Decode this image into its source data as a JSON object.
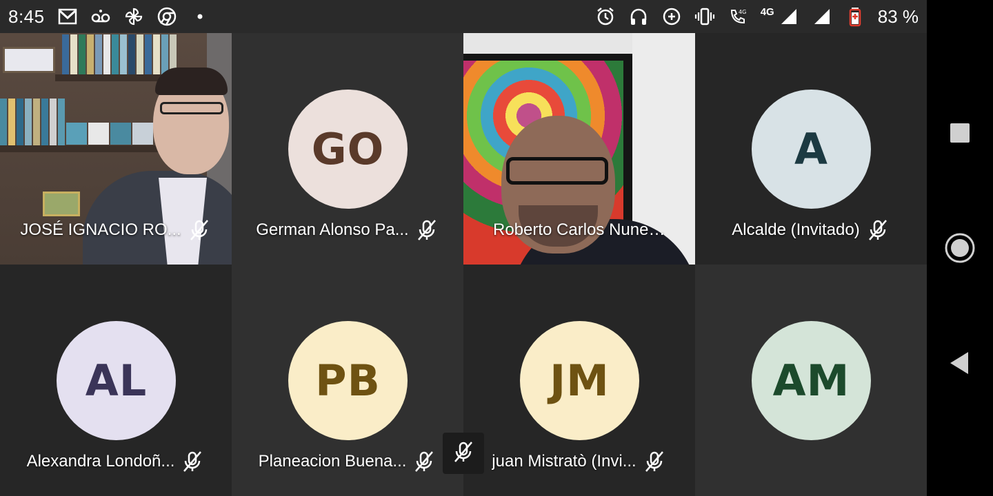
{
  "status_bar": {
    "time": "8:45",
    "left_icons": [
      "gmail-icon",
      "voicemail-icon",
      "pinwheel-icon",
      "chrome-icon",
      "notification-dot-icon"
    ],
    "right_icons": [
      "alarm-icon",
      "headphones-icon",
      "data-saver-icon",
      "vibrate-icon",
      "volte-call-icon",
      "signal-4g-icon",
      "signal-icon"
    ],
    "network_label": "4G",
    "volte_label": "4G",
    "battery_percent": "83 %"
  },
  "participants": [
    {
      "name": "JOSÉ IGNACIO RO...",
      "type": "video",
      "muted": true
    },
    {
      "name": "German Alonso Pa...",
      "type": "avatar",
      "initials": "GO",
      "avatar_bg": "#ece0dc",
      "avatar_fg": "#5a3a2a",
      "muted": true
    },
    {
      "name": "Roberto Carlos Nunez ...",
      "type": "video",
      "muted": false
    },
    {
      "name": "Alcalde (Invitado)",
      "type": "avatar",
      "initials": "A",
      "avatar_bg": "#d8e2e6",
      "avatar_fg": "#1c3a42",
      "muted": true
    },
    {
      "name": "Alexandra Londoñ...",
      "type": "avatar",
      "initials": "AL",
      "avatar_bg": "#e4e0f0",
      "avatar_fg": "#3a3458",
      "muted": true
    },
    {
      "name": "Planeacion Buena...",
      "type": "avatar",
      "initials": "PB",
      "avatar_bg": "#faedc8",
      "avatar_fg": "#6e5212",
      "muted": true
    },
    {
      "name": "juan Mistratò (Invi...",
      "type": "avatar",
      "initials": "JM",
      "avatar_bg": "#faedc8",
      "avatar_fg": "#6e5212",
      "muted": true
    },
    {
      "name": "",
      "type": "avatar",
      "initials": "AM",
      "avatar_bg": "#d4e4d8",
      "avatar_fg": "#1c4a2c",
      "muted": false
    }
  ],
  "nav_bar": {
    "buttons": [
      "recents-square-icon",
      "home-circle-icon",
      "back-triangle-icon"
    ]
  }
}
